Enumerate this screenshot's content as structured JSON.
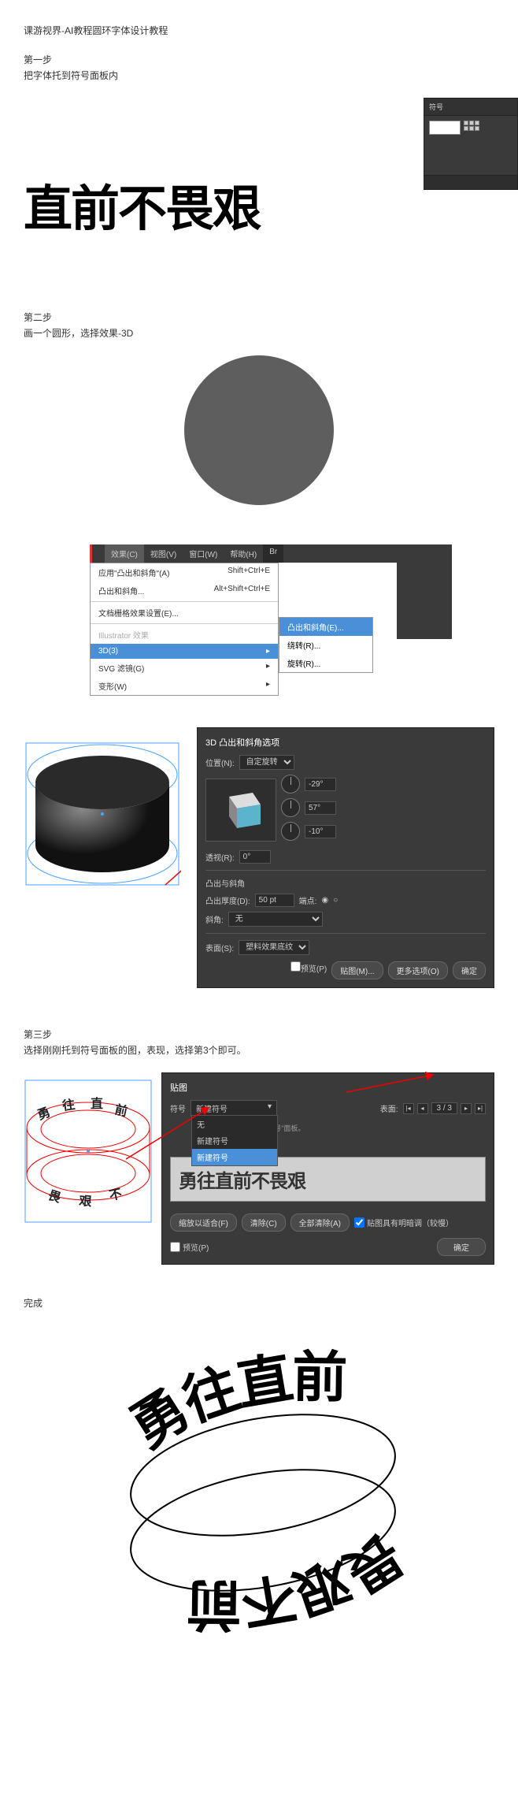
{
  "title": "课游视界-AI教程圆环字体设计教程",
  "step1": {
    "label": "第一步",
    "desc": "把字体托到符号面板内",
    "bigtext": "直前不畏艰",
    "panel_title": "符号"
  },
  "step2": {
    "label": "第二步",
    "desc": "画一个圆形，选择效果-3D",
    "menu": {
      "effect": "效果(C)",
      "view": "视图(V)",
      "window": "窗口(W)",
      "help": "帮助(H)",
      "br": "Br"
    },
    "items": {
      "apply": "应用\"凸出和斜角\"(A)",
      "apply_sc": "Shift+Ctrl+E",
      "extrude": "凸出和斜角...",
      "extrude_sc": "Alt+Shift+Ctrl+E",
      "docfx": "文档栅格效果设置(E)...",
      "illfx": "Illustrator 效果",
      "threed": "3D(3)",
      "svg": "SVG 滤镜(G)",
      "transform": "变形(W)"
    },
    "submenu": {
      "extrude": "凸出和斜角(E)...",
      "revolve": "绕转(R)...",
      "rotate": "旋转(R)..."
    }
  },
  "dialog3d": {
    "title": "3D 凸出和斜角选项",
    "position": "位置(N):",
    "position_val": "自定旋转",
    "rx": "-29°",
    "ry": "57°",
    "rz": "-10°",
    "perspective": "透视(R):",
    "perspective_val": "0°",
    "section": "凸出与斜角",
    "depth": "凸出厚度(D):",
    "depth_val": "50 pt",
    "cap": "端点:",
    "bevel": "斜角:",
    "bevel_val": "无",
    "surface": "表面(S):",
    "surface_val": "塑料效果底纹",
    "preview": "预览(P)",
    "map": "贴图(M)...",
    "more": "更多选项(O)",
    "ok": "确定"
  },
  "step3": {
    "label": "第三步",
    "desc": "选择刚刚托到符号面板的图，表现，选择第3个即可。",
    "panel_title": "贴图",
    "symbol": "符号",
    "symbol_val": "新建符号",
    "sym_none": "无",
    "sym_new": "新建符号",
    "sym_sel": "新建符号",
    "surface": "表面:",
    "surface_nav": "3 / 3",
    "hint": "\"符号\"面板。",
    "preview_text": "勇往直前不畏艰",
    "fit": "缩放以适合(F)",
    "clear": "清除(C)",
    "clearall": "全部清除(A)",
    "shade": "贴图具有明暗调（较慢）",
    "preview": "预览(P)",
    "ok": "确定"
  },
  "done": "完成"
}
